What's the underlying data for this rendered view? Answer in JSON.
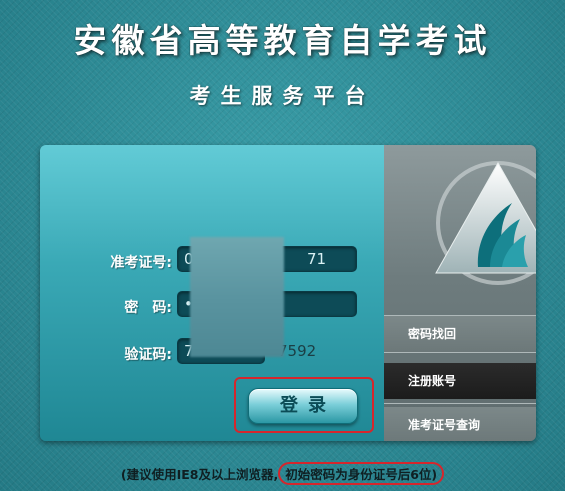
{
  "header": {
    "title": "安徽省高等教育自学考试",
    "subtitle": "考生服务平台"
  },
  "form": {
    "ticket_label": "准考证号:",
    "ticket_value_start": "0",
    "ticket_value_end": "71",
    "password_label": "密　码:",
    "password_value": "•",
    "captcha_label": "验证码:",
    "captcha_value": "7",
    "captcha_code": "7592",
    "login_label": "登录"
  },
  "side": {
    "links": [
      "密码找回",
      "注册账号",
      "准考证号查询"
    ]
  },
  "footer": {
    "tip_prefix": "(建议使用IE8及以上浏览器,",
    "tip_highlight": "初始密码为身份证号后6位)"
  },
  "colors": {
    "background": "#2e8e99",
    "highlight_border": "#d6262c",
    "active_link": "#1c1c1c"
  }
}
